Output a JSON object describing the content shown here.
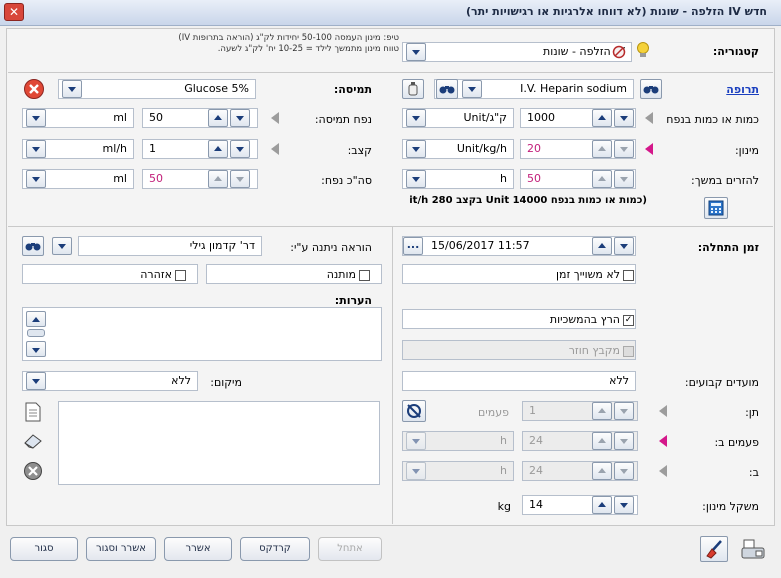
{
  "window": {
    "title": "חדש IV הזלפה - שונות   (לא דווחו אלרגיות או רגישויות יתר)",
    "close_glyph": "✕"
  },
  "tip": {
    "line1": "טיפ: מינון העמסה 50-100 יחידות לק\"ג (הוראה בתרופות IV)",
    "line2": "טווח מינון מתמשך לילד = 10-25 יח' לק\"ג לשעה."
  },
  "category": {
    "label": "קטגוריה:",
    "value": "IV הזלפה - שונות"
  },
  "drug": {
    "link_label": "תרופה",
    "value": "I.V. Heparin sodium",
    "amount_label": "כמות או כמות בנפח",
    "amount_value": "1000",
    "amount_unit": "Unit/ק\"ג",
    "dose_label": "מינון:",
    "dose_value": "20",
    "dose_unit": "Unit/kg/h",
    "continuous_label": "להזרים במשך:",
    "continuous_value": "50",
    "continuous_unit": "h",
    "summary": "(כמות או כמות בנפח Unit 14000 בקצב 280 it/h"
  },
  "solution": {
    "label": "תמיסה:",
    "value": "Glucose 5%",
    "volume_label": "נפח תמיסה:",
    "volume_value": "50",
    "volume_unit": "ml",
    "rate_label": "קצב:",
    "rate_value": "1",
    "rate_unit": "ml/h",
    "total_label": "סה\"כ נפח:",
    "total_value": "50",
    "total_unit": "ml"
  },
  "start": {
    "label": "זמן התחלה:",
    "value": "15/06/2017  11:57",
    "button": "...",
    "no_time_label": "לא משוייך זמן",
    "run_continuous_label": "הרץ בהמשכיות",
    "recurrent_label": "מקבץ חוזר"
  },
  "ordered_by": {
    "label": "הוראה ניתנה ע\"י:",
    "value": "דר' קדמון גילי"
  },
  "flags": {
    "conditional_label": "מותנה",
    "warning_label": "אזהרה"
  },
  "comments_label": "הערות:",
  "fixed_times": {
    "label": "מועדים קבועים:",
    "value": "ללא"
  },
  "location": {
    "label": "מיקום:",
    "value": "ללא"
  },
  "schedule": {
    "times_label": "תן:",
    "times_value": "1",
    "times_unit": "פעמים",
    "every_label": "פעמים ב:",
    "every_value": "24",
    "every_unit": "h",
    "during_label": "ב:",
    "during_value": "24",
    "during_unit": "h"
  },
  "weight": {
    "label": "משקל מינון:",
    "value": "14",
    "unit": "kg"
  },
  "buttons": {
    "cancel": "אתחל",
    "kardex": "קרדקס",
    "approve": "אשרר",
    "approve_close": "אשרר וסגור",
    "close": "סגור"
  },
  "icons": {
    "binoculars": "⛯",
    "calculator": "▦",
    "bulb": "💡"
  },
  "colors": {
    "pink": "#d4178a",
    "link": "#1a3fbf",
    "accent": "#1b3d7a"
  }
}
